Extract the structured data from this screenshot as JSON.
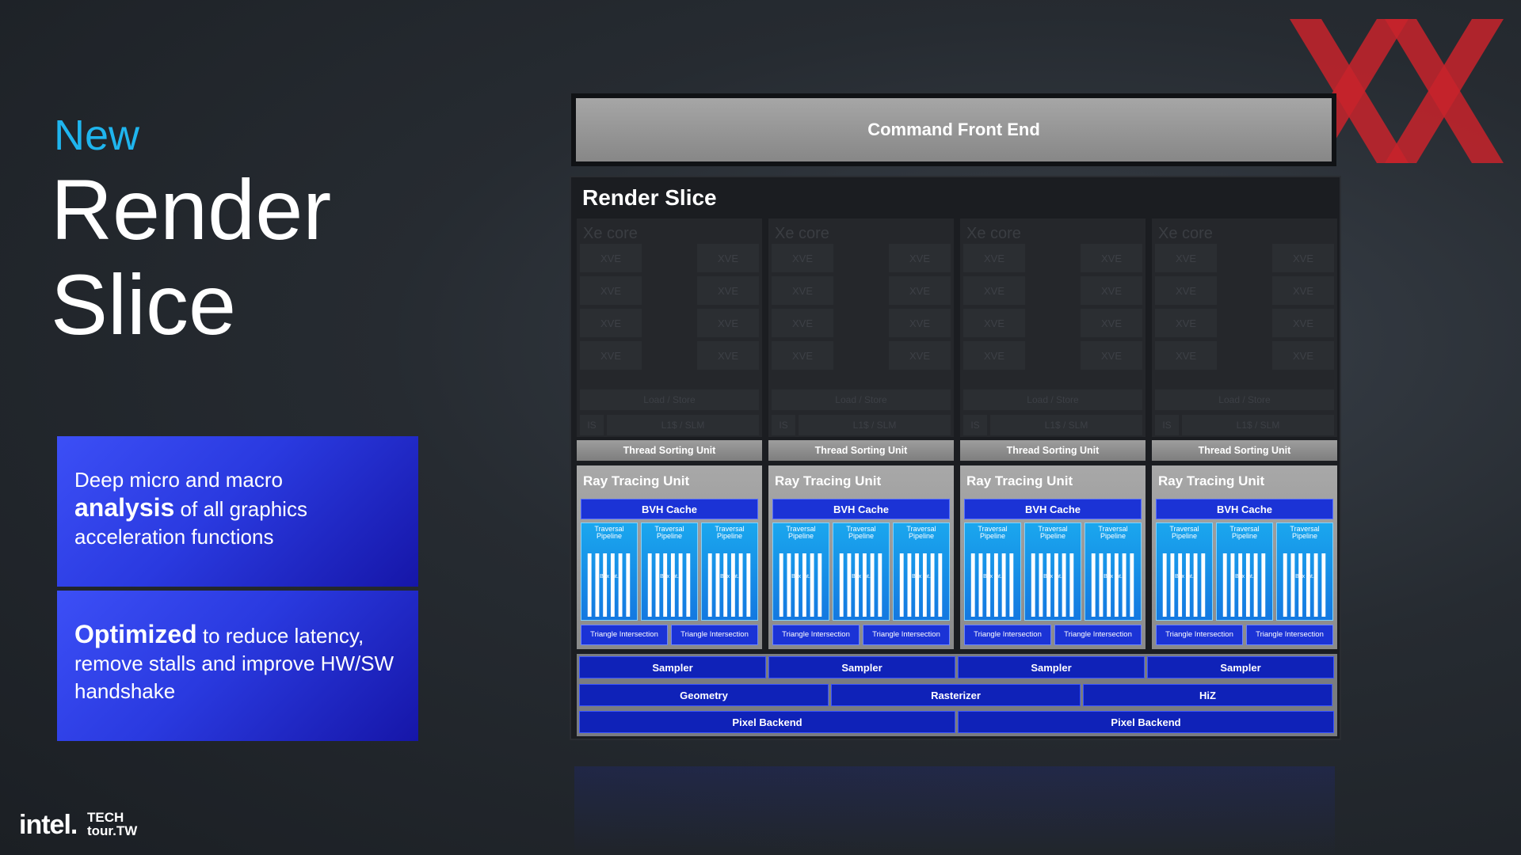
{
  "slide": {
    "kicker": "New",
    "title_line1": "Render",
    "title_line2": "Slice",
    "card1": {
      "line1": "Deep micro and macro",
      "bold": "analysis",
      "rest": " of all graphics acceleration functions"
    },
    "card2": {
      "bold": "Optimized",
      "rest": " to reduce latency, remove stalls and improve HW/SW handshake"
    },
    "footer": {
      "brand": "intel.",
      "event_line1": "TECH",
      "event_line2": "tour.TW"
    }
  },
  "diagram": {
    "command_front_end": "Command Front End",
    "render_slice_title": "Render Slice",
    "xe_core_label": "Xe core",
    "xve_label": "XVE",
    "load_store_label": "Load / Store",
    "is_label": "IS",
    "l1_label": "L1$ / SLM",
    "columns": [
      {
        "thread_sorting": "Thread Sorting Unit",
        "rtu_title": "Ray Tracing Unit",
        "bvh": "BVH Cache",
        "traversal": [
          "Traversal Pipeline",
          "Traversal Pipeline",
          "Traversal Pipeline"
        ],
        "box": "Box Int.",
        "triangle": [
          "Triangle Intersection",
          "Triangle Intersection"
        ]
      },
      {
        "thread_sorting": "Thread Sorting Unit",
        "rtu_title": "Ray Tracing Unit",
        "bvh": "BVH Cache",
        "traversal": [
          "Traversal Pipeline",
          "Traversal Pipeline",
          "Traversal Pipeline"
        ],
        "box": "Box Int.",
        "triangle": [
          "Triangle Intersection",
          "Triangle Intersection"
        ]
      },
      {
        "thread_sorting": "Thread Sorting Unit",
        "rtu_title": "Ray Tracing Unit",
        "bvh": "BVH Cache",
        "traversal": [
          "Traversal Pipeline",
          "Traversal Pipeline",
          "Traversal Pipeline"
        ],
        "box": "Box Int.",
        "triangle": [
          "Triangle Intersection",
          "Triangle Intersection"
        ]
      },
      {
        "thread_sorting": "Thread Sorting Unit",
        "rtu_title": "Ray Tracing Unit",
        "bvh": "BVH Cache",
        "traversal": [
          "Traversal Pipeline",
          "Traversal Pipeline",
          "Traversal Pipeline"
        ],
        "box": "Box Int.",
        "triangle": [
          "Triangle Intersection",
          "Triangle Intersection"
        ]
      }
    ],
    "samplers": [
      "Sampler",
      "Sampler",
      "Sampler",
      "Sampler"
    ],
    "geometry_row": [
      "Geometry",
      "Rasterizer",
      "HiZ"
    ],
    "pixel_backends": [
      "Pixel Backend",
      "Pixel Backend"
    ]
  },
  "colors": {
    "kicker": "#1fb5ee",
    "accent_blue": "#1b33d6",
    "logo_red": "#c8232c"
  }
}
